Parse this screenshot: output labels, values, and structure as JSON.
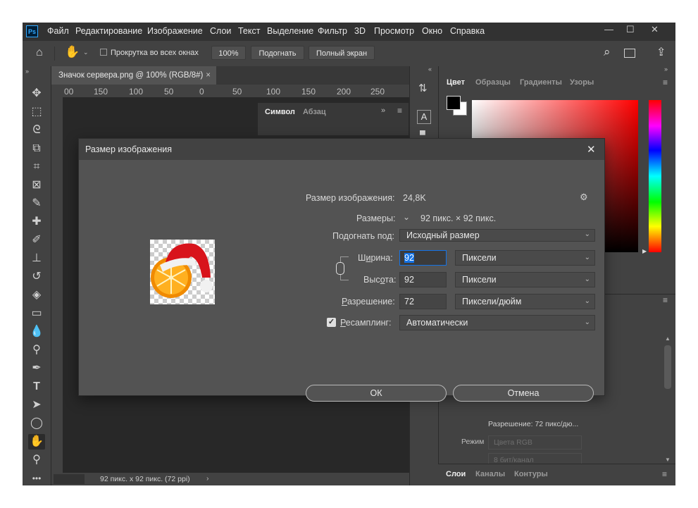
{
  "app": {
    "logo": "Ps"
  },
  "menubar": {
    "items": [
      "Файл",
      "Редактирование",
      "Изображение",
      "Слои",
      "Текст",
      "Выделение",
      "Фильтр",
      "3D",
      "Просмотр",
      "Окно",
      "Справка"
    ],
    "window_controls": [
      "—",
      "☐",
      "✕"
    ]
  },
  "options_bar": {
    "hand_tool_icon": "hand-icon",
    "scroll_all_label": "Прокрутка во всех окнах",
    "zoom_100": "100%",
    "fit_label": "Подогнать",
    "fullscreen_label": "Полный экран"
  },
  "document": {
    "tab_title": "Значок сервера.png @ 100% (RGB/8#)",
    "tab_close": "×",
    "ruler_labels": [
      "00",
      "150",
      "100",
      "50",
      "0",
      "50",
      "100",
      "150",
      "200",
      "250"
    ],
    "status": "92 пикс. x 92 пикс. (72 ppi)"
  },
  "character_panel": {
    "tabs": [
      "Символ",
      "Абзац"
    ]
  },
  "color_panel": {
    "tabs": [
      "Цвет",
      "Образцы",
      "Градиенты",
      "Узоры"
    ],
    "active_tab": "Цвет"
  },
  "properties_panel": {
    "resolution_text": "Разрешение: 72 пикс/дю...",
    "mode_label": "Режим",
    "mode_value": "Цвета RGB",
    "depth_value": "8 бит/канал"
  },
  "layers_panel": {
    "tabs": [
      "Слои",
      "Каналы",
      "Контуры"
    ]
  },
  "dialog": {
    "title": "Размер изображения",
    "close": "✕",
    "image_size_label": "Размер изображения:",
    "image_size_value": "24,8K",
    "dimensions_label": "Размеры:",
    "dimensions_value": "92 пикс.  ×  92 пикс.",
    "fit_to_label": "Подогнать под:",
    "fit_to_value": "Исходный размер",
    "width_label": "Ширина:",
    "width_value": "92",
    "width_unit": "Пиксели",
    "height_label": "Высота:",
    "height_value": "92",
    "height_unit": "Пиксели",
    "resolution_label": "Разрешение:",
    "resolution_value": "72",
    "resolution_unit": "Пиксели/дюйм",
    "resample_label": "Ресамплинг:",
    "resample_checked": true,
    "resample_value": "Автоматически",
    "ok_label": "ОК",
    "cancel_label": "Отмена"
  }
}
